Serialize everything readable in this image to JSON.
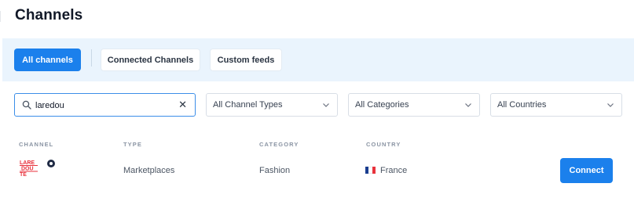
{
  "header": {
    "title": "Channels"
  },
  "tabs": [
    {
      "label": "All channels",
      "active": true
    },
    {
      "label": "Connected Channels",
      "active": false
    },
    {
      "label": "Custom feeds",
      "active": false
    }
  ],
  "filters": {
    "search": {
      "value": "laredou",
      "icon": "search-icon",
      "clear_icon": "close-icon",
      "clear_glyph": "✕"
    },
    "channel_type": {
      "selected": "All Channel Types"
    },
    "category": {
      "selected": "All Categories"
    },
    "country": {
      "selected": "All Countries"
    }
  },
  "table": {
    "columns": [
      "CHANNEL",
      "TYPE",
      "CATEGORY",
      "COUNTRY"
    ],
    "rows": [
      {
        "logo_text": "LARE DOU TE",
        "type": "Marketplaces",
        "category": "Fashion",
        "country": "France",
        "flag": "france-flag-icon",
        "action": "Connect"
      }
    ]
  },
  "colors": {
    "accent": "#1b80ec",
    "tab_bar_bg": "#eaf4fd",
    "logo_red": "#e8323c",
    "flag_blue": "#1a3d8f",
    "flag_red": "#e8323c"
  }
}
